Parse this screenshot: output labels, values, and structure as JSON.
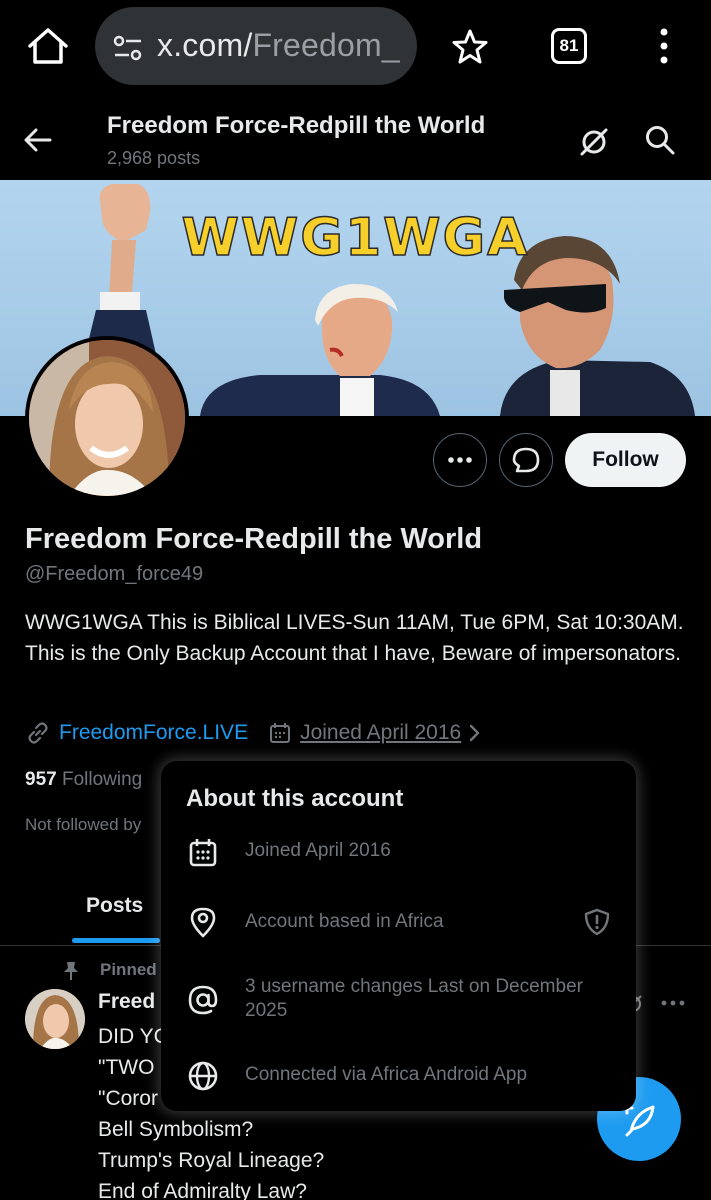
{
  "browser": {
    "url_main": "x.com/",
    "url_path": "Freedom_",
    "tab_count": "81",
    "icons": [
      "home-icon",
      "site-settings-icon",
      "bookmark-star-icon",
      "tabs-icon",
      "menu-icon"
    ]
  },
  "header": {
    "title": "Freedom Force-Redpill the World",
    "post_count": "2,968 posts",
    "icons": [
      "back-arrow-icon",
      "grok-icon",
      "search-icon"
    ]
  },
  "banner": {
    "text": "WWG1WGA"
  },
  "actions": {
    "more_label": "more",
    "message_label": "message",
    "follow_label": "Follow"
  },
  "profile": {
    "name": "Freedom Force-Redpill the World",
    "handle": "@Freedom_force49",
    "bio": "WWG1WGA This is Biblical LIVES-Sun 11AM, Tue 6PM, Sat 10:30AM. This is the Only Backup Account that I have, Beware of impersonators.",
    "website": "FreedomForce.LIVE",
    "joined": "Joined April 2016",
    "following_count": "957",
    "following_label": "Following",
    "not_followed": "Not followed by"
  },
  "tabs": {
    "posts": "Posts"
  },
  "pinned_post": {
    "pinned_label": "Pinned",
    "author": "Freed",
    "lines": [
      "DID YC",
      "\"TWO",
      "\"Coror",
      "Bell Symbolism?",
      "Trump's Royal Lineage?",
      "End of Admiralty Law?"
    ]
  },
  "about_popover": {
    "title": "About this account",
    "rows": [
      {
        "icon": "calendar-icon",
        "text": "Joined April 2016"
      },
      {
        "icon": "location-pin-icon",
        "text": "Account based in Africa"
      },
      {
        "icon": "at-sign-icon",
        "text": "3 username changes Last on December 2025"
      },
      {
        "icon": "globe-icon",
        "text": "Connected via Africa Android App"
      }
    ]
  },
  "colors": {
    "accent": "#1d9bf0",
    "text_primary": "#e7e9ea",
    "text_secondary": "#71767b",
    "background": "#000000",
    "follow_button_bg": "#eff3f4",
    "banner_text": "#f6cf2a"
  }
}
